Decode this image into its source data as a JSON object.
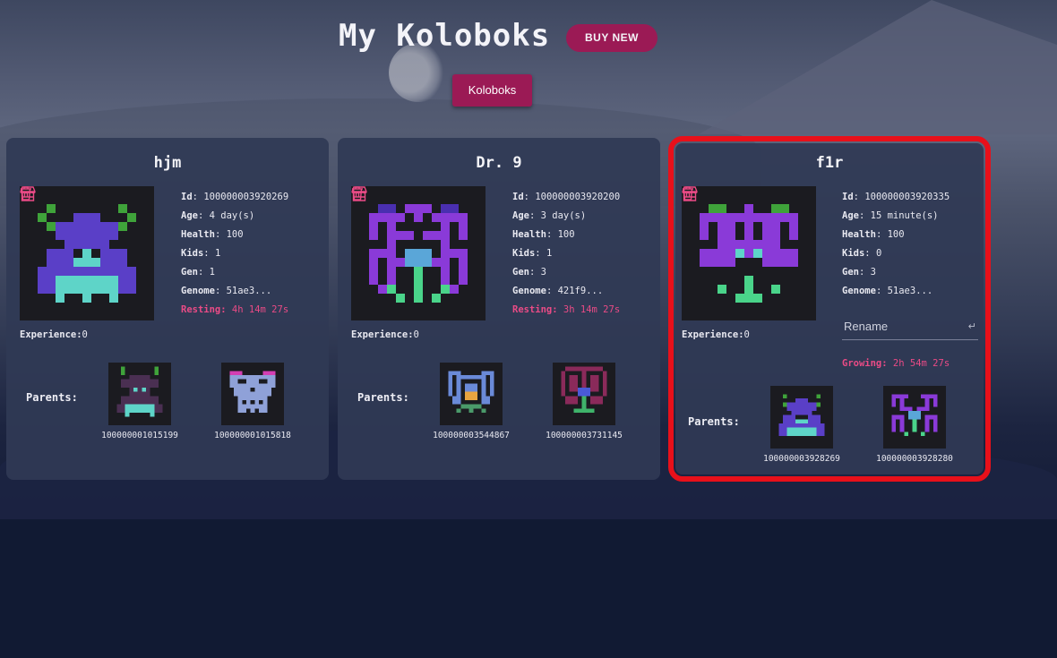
{
  "page": {
    "title": "My Koloboks",
    "buy_button": "BUY NEW",
    "nav_button": "Koloboks"
  },
  "labels": {
    "id": "Id",
    "age": "Age",
    "health": "Health",
    "kids": "Kids",
    "gen": "Gen",
    "genome": "Genome",
    "experience": "Experience:",
    "parents": "Parents",
    "colon": ":"
  },
  "cards": [
    {
      "name": "hjm",
      "id": "100000003920269",
      "age": "4 day(s)",
      "health": "100",
      "kids": "1",
      "gen": "1",
      "genome": "51ae3...",
      "status_label": "Resting",
      "status_time": "4h 14m 27s",
      "experience": "0",
      "parents": [
        "100000001015199",
        "100000001015818"
      ],
      "highlighted": false
    },
    {
      "name": "Dr. 9",
      "id": "100000003920200",
      "age": "3 day(s)",
      "health": "100",
      "kids": "1",
      "gen": "3",
      "genome": "421f9...",
      "status_label": "Resting",
      "status_time": "3h 14m 27s",
      "experience": "0",
      "parents": [
        "100000003544867",
        "100000003731145"
      ],
      "highlighted": false
    },
    {
      "name": "f1r",
      "id": "100000003920335",
      "age": "15 minute(s)",
      "health": "100",
      "kids": "0",
      "gen": "3",
      "genome": "51ae3...",
      "rename_placeholder": "Rename",
      "rename_enter": "↵",
      "status_label": "Growing",
      "status_time": "2h 54m 27s",
      "experience": "0",
      "parents": [
        "100000003928269",
        "100000003928280"
      ],
      "highlighted": true
    }
  ],
  "icons": {
    "delete": "trash-icon",
    "sell": "shop-icon"
  },
  "colors": {
    "accent": "#9b1a55",
    "status": "#ea4b86",
    "highlight": "#e8101a",
    "card_bg": "#303a55"
  }
}
